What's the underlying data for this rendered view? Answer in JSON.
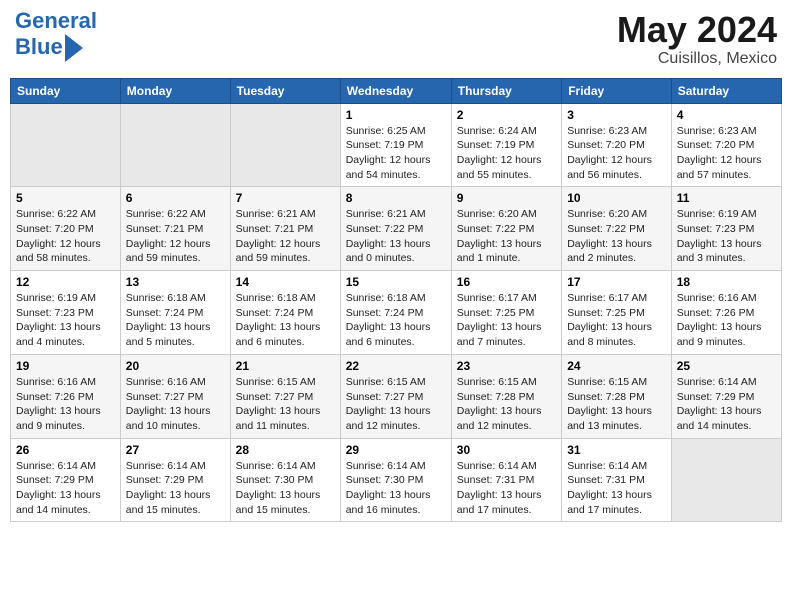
{
  "header": {
    "logo_text1": "General",
    "logo_text2": "Blue",
    "month": "May 2024",
    "location": "Cuisillos, Mexico"
  },
  "weekdays": [
    "Sunday",
    "Monday",
    "Tuesday",
    "Wednesday",
    "Thursday",
    "Friday",
    "Saturday"
  ],
  "weeks": [
    [
      {
        "day": "",
        "sunrise": "",
        "sunset": "",
        "daylight": ""
      },
      {
        "day": "",
        "sunrise": "",
        "sunset": "",
        "daylight": ""
      },
      {
        "day": "",
        "sunrise": "",
        "sunset": "",
        "daylight": ""
      },
      {
        "day": "1",
        "sunrise": "6:25 AM",
        "sunset": "7:19 PM",
        "daylight": "12 hours and 54 minutes."
      },
      {
        "day": "2",
        "sunrise": "6:24 AM",
        "sunset": "7:19 PM",
        "daylight": "12 hours and 55 minutes."
      },
      {
        "day": "3",
        "sunrise": "6:23 AM",
        "sunset": "7:20 PM",
        "daylight": "12 hours and 56 minutes."
      },
      {
        "day": "4",
        "sunrise": "6:23 AM",
        "sunset": "7:20 PM",
        "daylight": "12 hours and 57 minutes."
      }
    ],
    [
      {
        "day": "5",
        "sunrise": "6:22 AM",
        "sunset": "7:20 PM",
        "daylight": "12 hours and 58 minutes."
      },
      {
        "day": "6",
        "sunrise": "6:22 AM",
        "sunset": "7:21 PM",
        "daylight": "12 hours and 59 minutes."
      },
      {
        "day": "7",
        "sunrise": "6:21 AM",
        "sunset": "7:21 PM",
        "daylight": "12 hours and 59 minutes."
      },
      {
        "day": "8",
        "sunrise": "6:21 AM",
        "sunset": "7:22 PM",
        "daylight": "13 hours and 0 minutes."
      },
      {
        "day": "9",
        "sunrise": "6:20 AM",
        "sunset": "7:22 PM",
        "daylight": "13 hours and 1 minute."
      },
      {
        "day": "10",
        "sunrise": "6:20 AM",
        "sunset": "7:22 PM",
        "daylight": "13 hours and 2 minutes."
      },
      {
        "day": "11",
        "sunrise": "6:19 AM",
        "sunset": "7:23 PM",
        "daylight": "13 hours and 3 minutes."
      }
    ],
    [
      {
        "day": "12",
        "sunrise": "6:19 AM",
        "sunset": "7:23 PM",
        "daylight": "13 hours and 4 minutes."
      },
      {
        "day": "13",
        "sunrise": "6:18 AM",
        "sunset": "7:24 PM",
        "daylight": "13 hours and 5 minutes."
      },
      {
        "day": "14",
        "sunrise": "6:18 AM",
        "sunset": "7:24 PM",
        "daylight": "13 hours and 6 minutes."
      },
      {
        "day": "15",
        "sunrise": "6:18 AM",
        "sunset": "7:24 PM",
        "daylight": "13 hours and 6 minutes."
      },
      {
        "day": "16",
        "sunrise": "6:17 AM",
        "sunset": "7:25 PM",
        "daylight": "13 hours and 7 minutes."
      },
      {
        "day": "17",
        "sunrise": "6:17 AM",
        "sunset": "7:25 PM",
        "daylight": "13 hours and 8 minutes."
      },
      {
        "day": "18",
        "sunrise": "6:16 AM",
        "sunset": "7:26 PM",
        "daylight": "13 hours and 9 minutes."
      }
    ],
    [
      {
        "day": "19",
        "sunrise": "6:16 AM",
        "sunset": "7:26 PM",
        "daylight": "13 hours and 9 minutes."
      },
      {
        "day": "20",
        "sunrise": "6:16 AM",
        "sunset": "7:27 PM",
        "daylight": "13 hours and 10 minutes."
      },
      {
        "day": "21",
        "sunrise": "6:15 AM",
        "sunset": "7:27 PM",
        "daylight": "13 hours and 11 minutes."
      },
      {
        "day": "22",
        "sunrise": "6:15 AM",
        "sunset": "7:27 PM",
        "daylight": "13 hours and 12 minutes."
      },
      {
        "day": "23",
        "sunrise": "6:15 AM",
        "sunset": "7:28 PM",
        "daylight": "13 hours and 12 minutes."
      },
      {
        "day": "24",
        "sunrise": "6:15 AM",
        "sunset": "7:28 PM",
        "daylight": "13 hours and 13 minutes."
      },
      {
        "day": "25",
        "sunrise": "6:14 AM",
        "sunset": "7:29 PM",
        "daylight": "13 hours and 14 minutes."
      }
    ],
    [
      {
        "day": "26",
        "sunrise": "6:14 AM",
        "sunset": "7:29 PM",
        "daylight": "13 hours and 14 minutes."
      },
      {
        "day": "27",
        "sunrise": "6:14 AM",
        "sunset": "7:29 PM",
        "daylight": "13 hours and 15 minutes."
      },
      {
        "day": "28",
        "sunrise": "6:14 AM",
        "sunset": "7:30 PM",
        "daylight": "13 hours and 15 minutes."
      },
      {
        "day": "29",
        "sunrise": "6:14 AM",
        "sunset": "7:30 PM",
        "daylight": "13 hours and 16 minutes."
      },
      {
        "day": "30",
        "sunrise": "6:14 AM",
        "sunset": "7:31 PM",
        "daylight": "13 hours and 17 minutes."
      },
      {
        "day": "31",
        "sunrise": "6:14 AM",
        "sunset": "7:31 PM",
        "daylight": "13 hours and 17 minutes."
      },
      {
        "day": "",
        "sunrise": "",
        "sunset": "",
        "daylight": ""
      }
    ]
  ]
}
